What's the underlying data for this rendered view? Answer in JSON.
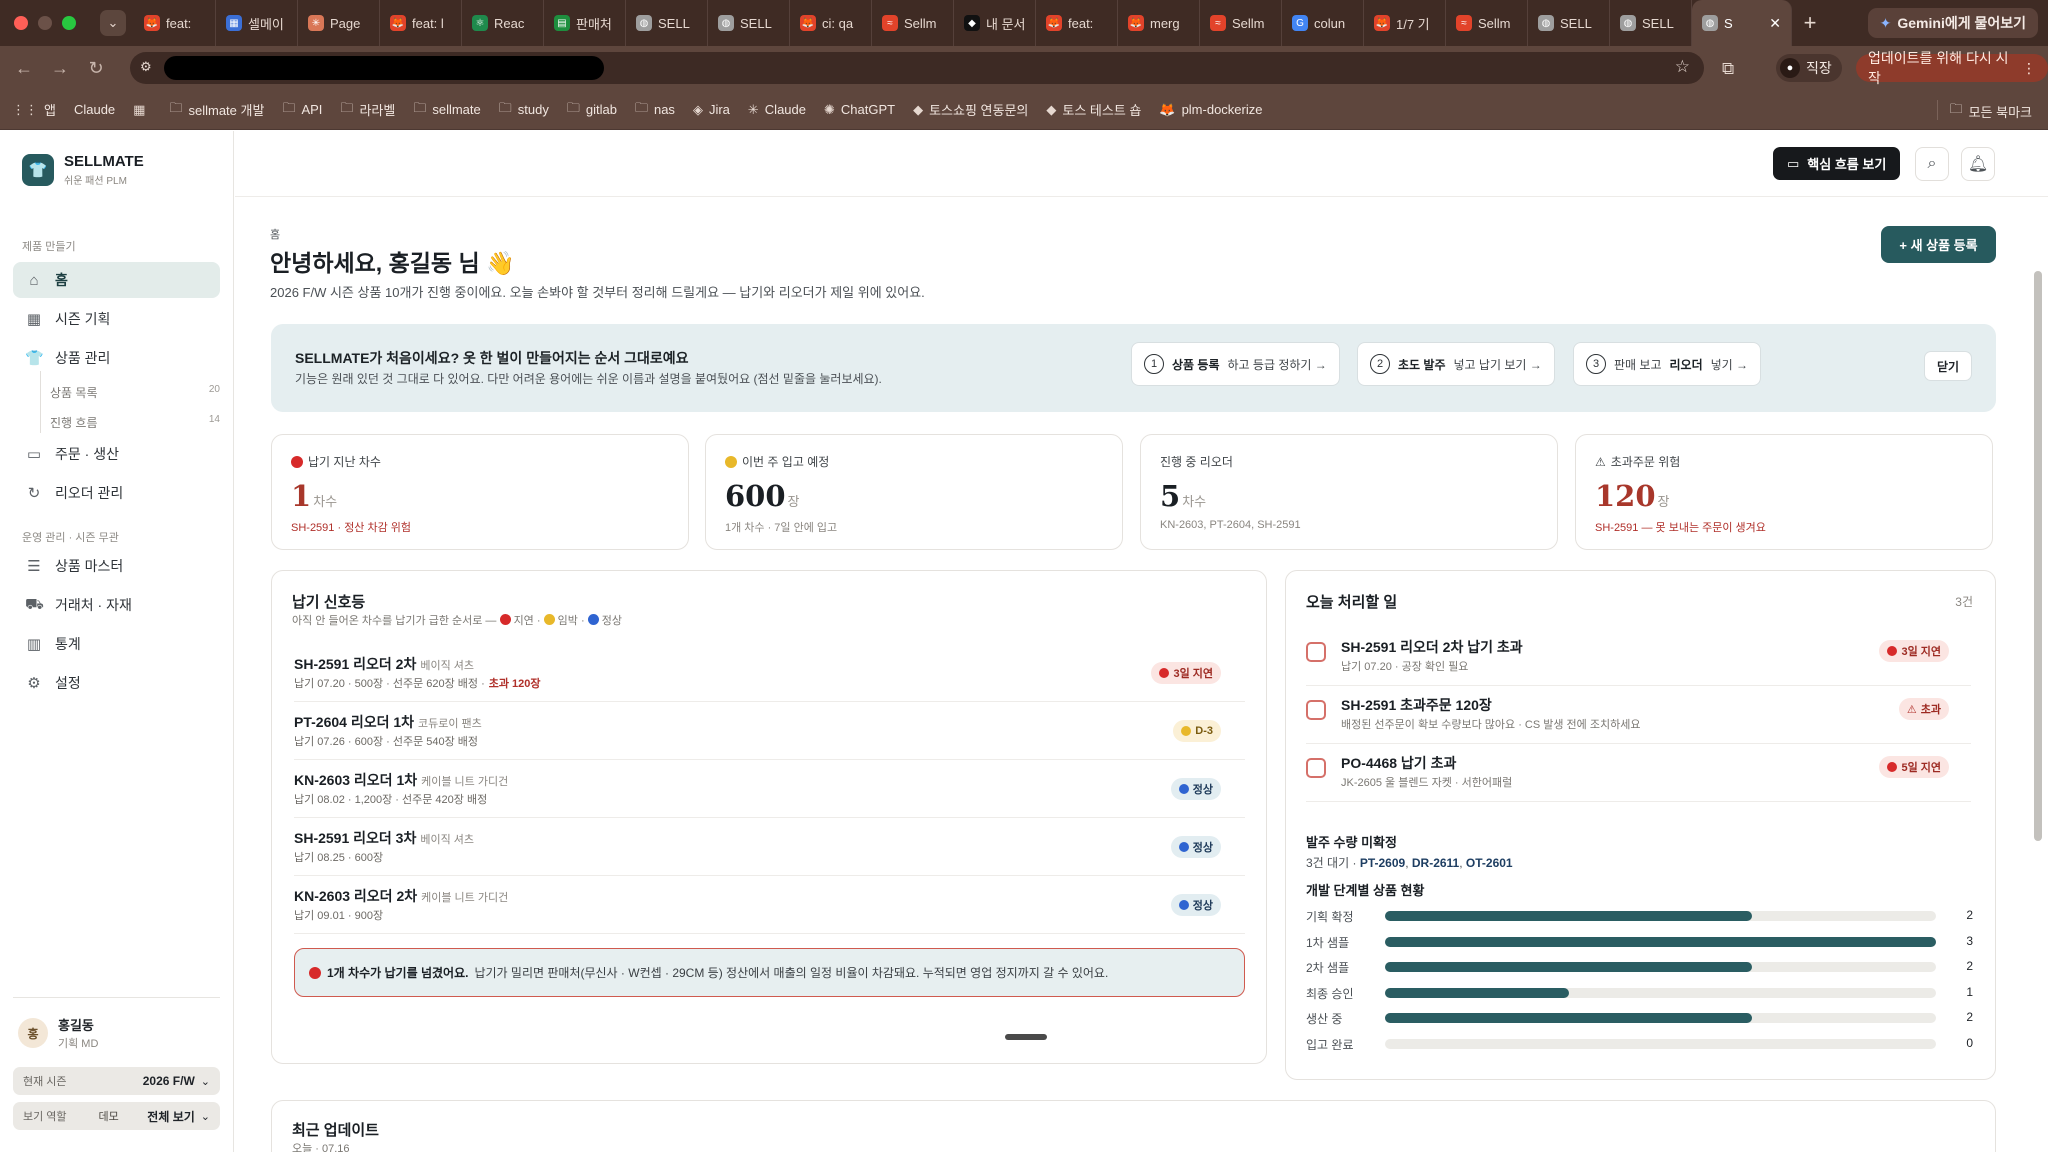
{
  "browser": {
    "tabs": [
      {
        "label": "feat:",
        "icon": "gitlab-icon",
        "color": "#e2432a"
      },
      {
        "label": "셀메이",
        "icon": "calendar-icon",
        "color": "#3b6fd6"
      },
      {
        "label": "Page",
        "icon": "claude-icon",
        "color": "#d97757"
      },
      {
        "label": "feat: l",
        "icon": "gitlab-icon",
        "color": "#e2432a"
      },
      {
        "label": "Reac",
        "icon": "react-icon",
        "color": "#1f8a4c"
      },
      {
        "label": "판매처",
        "icon": "sheets-icon",
        "color": "#1e8e3e"
      },
      {
        "label": "SELL",
        "icon": "globe-icon",
        "color": "#9e9e9e"
      },
      {
        "label": "SELL",
        "icon": "globe-icon",
        "color": "#9e9e9e"
      },
      {
        "label": "ci: qa",
        "icon": "gitlab-icon",
        "color": "#e2432a"
      },
      {
        "label": "Sellm",
        "icon": "wave-icon",
        "color": "#e2432a"
      },
      {
        "label": "내 문서",
        "icon": "notion-icon",
        "color": "#111111"
      },
      {
        "label": "feat:",
        "icon": "gitlab-icon",
        "color": "#e2432a"
      },
      {
        "label": "merg",
        "icon": "gitlab-icon",
        "color": "#e2432a"
      },
      {
        "label": "Sellm",
        "icon": "wave-icon",
        "color": "#e2432a"
      },
      {
        "label": "colun",
        "icon": "google-icon",
        "color": "#4285f4"
      },
      {
        "label": "1/7 기",
        "icon": "gitlab-icon",
        "color": "#e2432a"
      },
      {
        "label": "Sellm",
        "icon": "wave-icon",
        "color": "#e2432a"
      },
      {
        "label": "SELL",
        "icon": "globe-icon",
        "color": "#9e9e9e"
      },
      {
        "label": "SELL",
        "icon": "globe-icon",
        "color": "#9e9e9e"
      }
    ],
    "active_tab": {
      "label": "S",
      "icon": "globe-icon"
    },
    "gemini_label": "Gemini에게 물어보기",
    "profile_label": "직장",
    "update_label": "업데이트를 위해 다시 시작",
    "bookmarks": [
      {
        "label": "앱",
        "icon": "apps-icon"
      },
      {
        "label": "Claude",
        "icon": "none"
      },
      {
        "label": "",
        "icon": "grid-icon"
      },
      {
        "label": "sellmate 개발",
        "icon": "folder-icon"
      },
      {
        "label": "API",
        "icon": "folder-icon"
      },
      {
        "label": "라라벨",
        "icon": "folder-icon"
      },
      {
        "label": "sellmate",
        "icon": "folder-icon"
      },
      {
        "label": "study",
        "icon": "folder-icon"
      },
      {
        "label": "gitlab",
        "icon": "folder-icon"
      },
      {
        "label": "nas",
        "icon": "folder-icon"
      },
      {
        "label": "Jira",
        "icon": "jira-icon"
      },
      {
        "label": "Claude",
        "icon": "claude-icon"
      },
      {
        "label": "ChatGPT",
        "icon": "chatgpt-icon"
      },
      {
        "label": "토스쇼핑 연동문의",
        "icon": "toss-icon"
      },
      {
        "label": "토스 테스트 숍",
        "icon": "toss-icon"
      },
      {
        "label": "plm-dockerize",
        "icon": "gitlab-icon"
      }
    ],
    "all_bookmarks_label": "모든 북마크"
  },
  "sidebar": {
    "brand_name": "SELLMATE",
    "brand_sub": "쉬운 패션 PLM",
    "section1": "제품 만들기",
    "items": [
      {
        "label": "홈",
        "icon": "home-icon"
      },
      {
        "label": "시즌 기획",
        "icon": "calendar-icon"
      },
      {
        "label": "상품 관리",
        "icon": "shirt-icon"
      },
      {
        "label": "주문 · 생산",
        "icon": "briefcase-icon"
      },
      {
        "label": "리오더 관리",
        "icon": "refresh-icon"
      }
    ],
    "sub_items": [
      {
        "label": "상품 목록",
        "count": "20"
      },
      {
        "label": "진행 흐름",
        "count": "14"
      }
    ],
    "section2": "운영 관리 · 시즌 무관",
    "items2": [
      {
        "label": "상품 마스터",
        "icon": "database-icon"
      },
      {
        "label": "거래처 · 자재",
        "icon": "truck-icon"
      },
      {
        "label": "통계",
        "icon": "bar-chart-icon"
      },
      {
        "label": "설정",
        "icon": "gear-icon"
      }
    ],
    "user_initial": "홍",
    "user_name": "홍길동",
    "user_role": "기획 MD",
    "season_label": "현재 시즌",
    "season_value": "2026 F/W",
    "role_label": "보기 역할",
    "role_mid": "데모",
    "role_value": "전체 보기"
  },
  "topbar": {
    "flow_button": "핵심 흐름 보기"
  },
  "main": {
    "breadcrumb": "홈",
    "title": "안녕하세요, 홍길동 님 👋",
    "lead": "2026 F/W 시즌 상품 10개가 진행 중이에요. 오늘 손봐야 할 것부터 정리해 드릴게요 — 납기와 리오더가 제일 위에 있어요.",
    "new_button": "+ 새 상품 등록",
    "onboarding": {
      "title": "SELLMATE가 처음이세요? 옷 한 벌이 만들어지는 순서 그대로예요",
      "desc": "기능은 원래 있던 것 그대로 다 있어요. 다만 어려운 용어에는 쉬운 이름과 설명을 붙여뒀어요 (점선 밑줄을 눌러보세요).",
      "steps": [
        {
          "num": "1",
          "bold": "상품 등록",
          "rest": "하고 등급 정하기 →"
        },
        {
          "num": "2",
          "bold": "초도 발주",
          "rest": "넣고 납기 보기 →"
        },
        {
          "num": "3",
          "pre": "판매 보고",
          "bold": "리오더",
          "rest": "넣기 →"
        }
      ],
      "close_label": "닫기"
    },
    "stats": [
      {
        "label": "납기 지난 차수",
        "indicator": "red-dot",
        "value": "1",
        "unit": "차수",
        "sub": "SH-2591 · 정산 차감 위험",
        "value_color": "#a8372b",
        "sub_color": "#b0302a"
      },
      {
        "label": "이번 주 입고 예정",
        "indicator": "yellow-dot",
        "value": "600",
        "unit": "장",
        "sub": "1개 차수 · 7일 안에 입고",
        "value_color": "#1a1f24",
        "sub_color": "#8a8680"
      },
      {
        "label": "진행 중 리오더",
        "indicator": "none",
        "value": "5",
        "unit": "차수",
        "sub": "KN-2603, PT-2604, SH-2591",
        "value_color": "#1a1f24",
        "sub_color": "#8a8680"
      },
      {
        "label": "초과주문 위험",
        "indicator": "warning-icon",
        "value": "120",
        "unit": "장",
        "sub": "SH-2591 — 못 보내는 주문이 생겨요",
        "value_color": "#a8372b",
        "sub_color": "#b0302a"
      }
    ],
    "delivery": {
      "title": "납기 신호등",
      "legend_prefix": "아직 안 들어온 차수를 납기가 급한 순서로 —",
      "legend_red": "지연",
      "legend_yellow": "임박",
      "legend_blue": "정상",
      "rows": [
        {
          "code": "SH-2591 리오더 2차",
          "name": "베이직 셔츠",
          "meta": "납기 07.20 · 500장 · 선주문 620장 배정 ·",
          "over": "초과 120장",
          "badge": "3일 지연",
          "status": "red"
        },
        {
          "code": "PT-2604 리오더 1차",
          "name": "코듀로이 팬츠",
          "meta": "납기 07.26 · 600장 · 선주문 540장 배정",
          "over": "",
          "badge": "D-3",
          "status": "yellow"
        },
        {
          "code": "KN-2603 리오더 1차",
          "name": "케이블 니트 가디건",
          "meta": "납기 08.02 · 1,200장 · 선주문 420장 배정",
          "over": "",
          "badge": "정상",
          "status": "blue"
        },
        {
          "code": "SH-2591 리오더 3차",
          "name": "베이직 셔츠",
          "meta": "납기 08.25 · 600장",
          "over": "",
          "badge": "정상",
          "status": "blue"
        },
        {
          "code": "KN-2603 리오더 2차",
          "name": "케이블 니트 가디건",
          "meta": "납기 09.01 · 900장",
          "over": "",
          "badge": "정상",
          "status": "blue"
        }
      ],
      "alert_bold": "1개 차수가 납기를 넘겼어요.",
      "alert_text": "납기가 밀리면 판매처(무신사 · W컨셉 · 29CM 등) 정산에서 매출의 일정 비율이 차감돼요. 누적되면 영업 정지까지 갈 수 있어요."
    },
    "today": {
      "title": "오늘 처리할 일",
      "count": "3건",
      "tasks": [
        {
          "title": "SH-2591 리오더 2차 납기 초과",
          "sub": "납기 07.20 · 공장 확인 필요",
          "badge": "3일 지연",
          "type": "red-dot"
        },
        {
          "title": "SH-2591 초과주문 120장",
          "sub": "배정된 선주문이 확보 수량보다 많아요 · CS 발생 전에 조치하세요",
          "badge": "초과",
          "type": "warning"
        },
        {
          "title": "PO-4468 납기 초과",
          "sub": "JK-2605 울 블렌드 자켓 · 서한어패럴",
          "badge": "5일 지연",
          "type": "red-dot"
        }
      ],
      "pending_title": "발주 수량 미확정",
      "pending_prefix": "3건 대기 ·",
      "pending_codes": [
        "PT-2609",
        "DR-2611",
        "OT-2601"
      ],
      "dev_title": "개발 단계별 상품 현황",
      "dev_max": 3,
      "dev_stages": [
        {
          "label": "기획 확정",
          "value": 2
        },
        {
          "label": "1차 샘플",
          "value": 3
        },
        {
          "label": "2차 샘플",
          "value": 2
        },
        {
          "label": "최종 승인",
          "value": 1
        },
        {
          "label": "생산 중",
          "value": 2
        },
        {
          "label": "입고 완료",
          "value": 0
        }
      ]
    },
    "recent": {
      "title": "최근 업데이트",
      "sub": "오늘 · 07.16"
    }
  }
}
